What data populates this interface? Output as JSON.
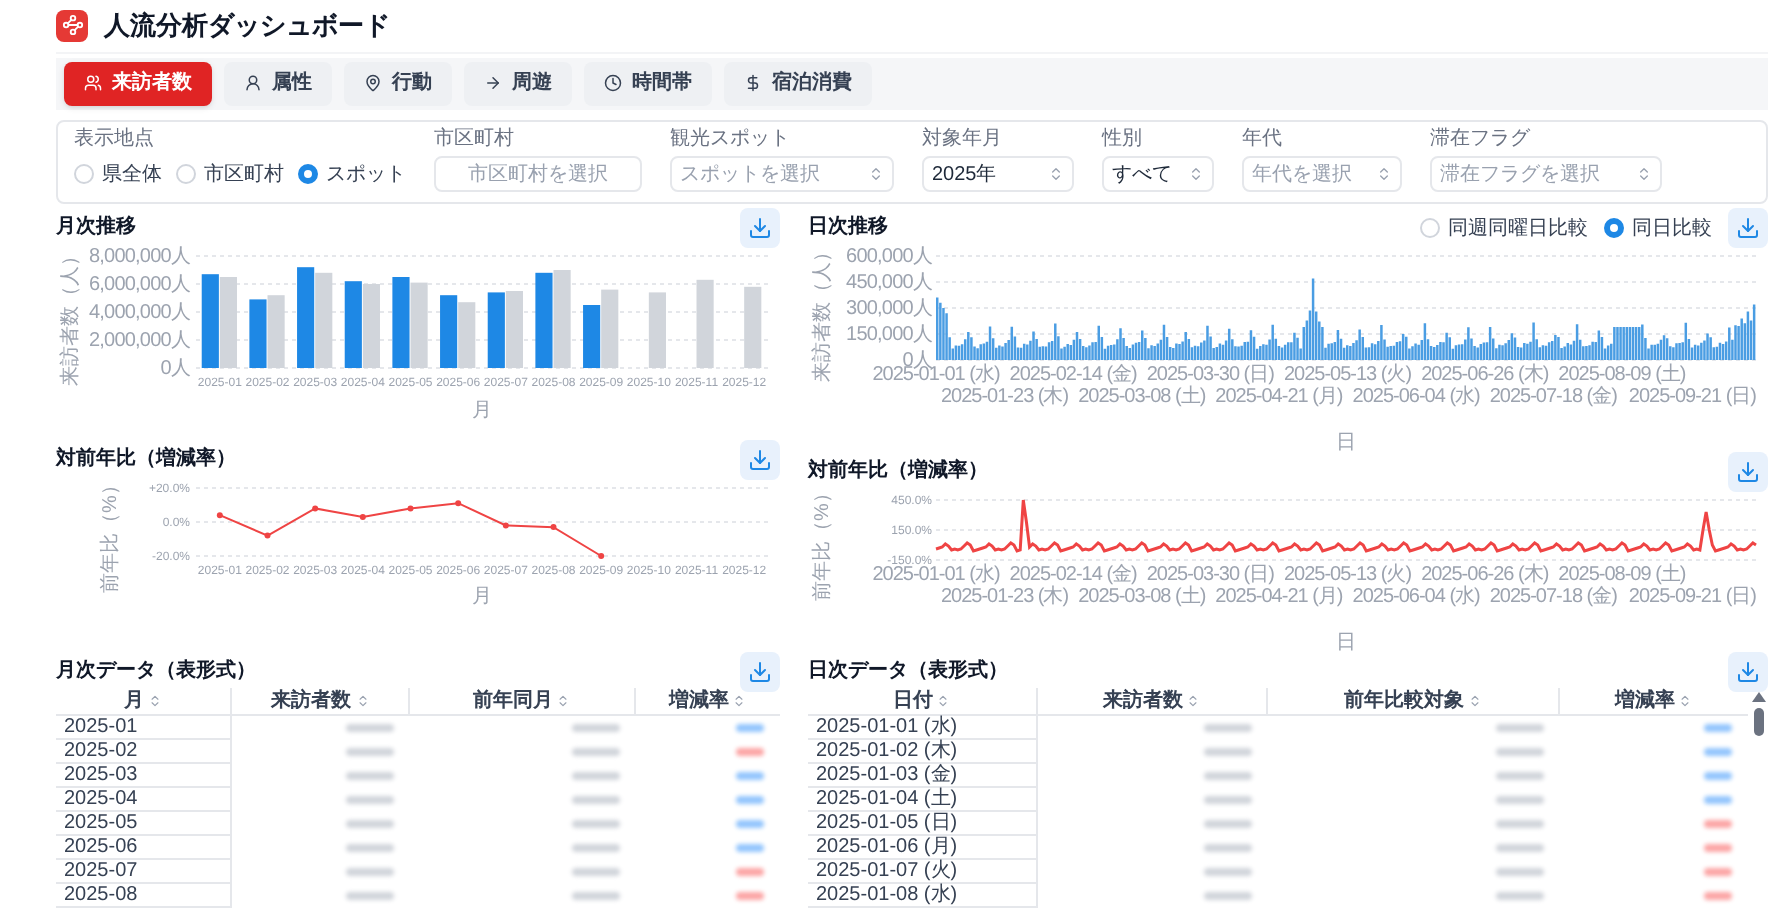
{
  "header": {
    "title": "人流分析ダッシュボード"
  },
  "tabs": [
    {
      "label": "来訪者数",
      "selected": true
    },
    {
      "label": "属性",
      "selected": false
    },
    {
      "label": "行動",
      "selected": false
    },
    {
      "label": "周遊",
      "selected": false
    },
    {
      "label": "時間帯",
      "selected": false
    },
    {
      "label": "宿泊消費",
      "selected": false
    }
  ],
  "filters": {
    "location": {
      "label": "表示地点",
      "options": [
        {
          "label": "県全体",
          "selected": false
        },
        {
          "label": "市区町村",
          "selected": false
        },
        {
          "label": "スポット",
          "selected": true
        }
      ]
    },
    "fields": [
      {
        "kind": "input",
        "label": "市区町村",
        "placeholder": "市区町村を選択"
      },
      {
        "kind": "select",
        "label": "観光スポット",
        "placeholder": "スポットを選択"
      },
      {
        "kind": "select",
        "label": "対象年月",
        "value": "2025年"
      },
      {
        "kind": "select",
        "label": "性別",
        "value": "すべて"
      },
      {
        "kind": "select",
        "label": "年代",
        "placeholder": "年代を選択"
      },
      {
        "kind": "select",
        "label": "滞在フラグ",
        "placeholder": "滞在フラグを選択"
      }
    ]
  },
  "monthly_trend": {
    "title": "月次推移",
    "chart_data": {
      "type": "bar",
      "xlabel": "月",
      "ylabel": "来訪者数（人）",
      "categories": [
        "2025-01",
        "2025-02",
        "2025-03",
        "2025-04",
        "2025-05",
        "2025-06",
        "2025-07",
        "2025-08",
        "2025-09",
        "2025-10",
        "2025-11",
        "2025-12"
      ],
      "grid": true,
      "series": [
        {
          "color": "#1e88e5",
          "values": [
            6700000,
            4900000,
            7200000,
            6200000,
            6500000,
            5200000,
            5400000,
            6800000,
            4500000,
            null,
            null,
            null
          ]
        },
        {
          "color": "#d1d5db",
          "values": [
            6500000,
            5200000,
            6800000,
            6000000,
            6100000,
            4700000,
            5500000,
            7000000,
            5600000,
            5400000,
            6300000,
            5800000
          ]
        }
      ],
      "ylim": [
        0,
        8000000
      ],
      "yticks": [
        {
          "value": 0,
          "label": "0人"
        },
        {
          "value": 2000000,
          "label": "2,000,000人"
        },
        {
          "value": 4000000,
          "label": "4,000,000人"
        },
        {
          "value": 6000000,
          "label": "6,000,000人"
        },
        {
          "value": 8000000,
          "label": "8,000,000人"
        }
      ]
    }
  },
  "monthly_yoy": {
    "title": "対前年比（増減率）",
    "chart_data": {
      "type": "line",
      "xlabel": "月",
      "ylabel": "前年比（%）",
      "categories": [
        "2025-01",
        "2025-02",
        "2025-03",
        "2025-04",
        "2025-05",
        "2025-06",
        "2025-07",
        "2025-08",
        "2025-09",
        "2025-10",
        "2025-11",
        "2025-12"
      ],
      "grid": true,
      "series": [
        {
          "color": "#ef4444",
          "marker": "circle",
          "values": [
            4,
            -8,
            8,
            3,
            8,
            11,
            -2,
            -3,
            -20,
            null,
            null,
            null
          ]
        }
      ],
      "ylim": [
        -20,
        20
      ],
      "yticks": [
        {
          "value": -20,
          "label": "-20.0%"
        },
        {
          "value": 0,
          "label": "0.0%"
        },
        {
          "value": 20,
          "label": "+20.0%"
        }
      ]
    }
  },
  "daily_trend": {
    "title": "日次推移",
    "comparison": [
      {
        "label": "同週同曜日比較",
        "selected": false
      },
      {
        "label": "同日比較",
        "selected": true
      }
    ],
    "ylabel": "来訪者数（人）",
    "xlabel": "日",
    "y_ticks": [
      "600,000人",
      "450,000人",
      "300,000人",
      "150,000人",
      "0人"
    ],
    "x_ticks": [
      "2025-01-01 (水)",
      "2025-01-23 (木)",
      "2025-02-14 (金)",
      "2025-03-08 (土)",
      "2025-03-30 (日)",
      "2025-04-21 (月)",
      "2025-05-13 (火)",
      "2025-06-04 (水)",
      "2025-06-26 (木)",
      "2025-07-18 (金)",
      "2025-08-09 (土)",
      "2025-09-21 (日)"
    ]
  },
  "daily_yoy": {
    "title": "対前年比（増減率）",
    "chart_data": {
      "type": "line",
      "ylabel": "前年比（%）",
      "xlabel": "日",
      "grid": true,
      "ylim": [
        -150,
        450
      ],
      "yticks": [
        {
          "value": 450,
          "label": "450.0%"
        },
        {
          "value": 150,
          "label": "150.0%"
        },
        {
          "value": -150,
          "label": "-150.0%"
        }
      ],
      "series": [
        {
          "color": "#ef4444",
          "values": [
            -40,
            -30,
            -20,
            10,
            -10,
            -50,
            -40,
            -50,
            -40,
            -10,
            20,
            0,
            -60,
            -50,
            -40,
            -30,
            -20,
            10,
            -10,
            -50,
            -40,
            -50,
            -40,
            -10,
            20,
            0,
            -60,
            -50,
            450,
            230,
            -20,
            10,
            -10,
            -50,
            -40,
            -50,
            -40,
            -10,
            20,
            0,
            -60,
            -50,
            -40,
            -30,
            -20,
            10,
            -10,
            -50,
            -40,
            -50,
            -40,
            -10,
            20,
            0,
            -60,
            -50,
            -40,
            -30,
            -20,
            10,
            -10,
            -50,
            -40,
            -50,
            -40,
            -10,
            20,
            0,
            -60,
            -50,
            -40,
            -30,
            -20,
            10,
            -10,
            -50,
            -40,
            -50,
            -40,
            -10,
            20,
            0,
            -60,
            -50,
            -40,
            -30,
            -20,
            10,
            -10,
            -50,
            -40,
            -50,
            -40,
            -10,
            20,
            0,
            -60,
            -50,
            -40,
            -30,
            -20,
            10,
            -10,
            -50,
            -40,
            -50,
            -40,
            -10,
            20,
            0,
            -60,
            -50,
            -40,
            -30,
            -20,
            10,
            -10,
            -50,
            -40,
            -50,
            -40,
            -10,
            20,
            0,
            -60,
            -50,
            -40,
            -30,
            -20,
            10,
            -10,
            -50,
            -40,
            -50,
            -40,
            -10,
            20,
            0,
            -60,
            -50,
            -40,
            -30,
            -20,
            10,
            -10,
            -50,
            -40,
            -50,
            -40,
            -10,
            20,
            0,
            -60,
            -50,
            -40,
            -30,
            -20,
            10,
            -10,
            -50,
            -40,
            -50,
            -40,
            -10,
            20,
            0,
            -60,
            -50,
            -40,
            -30,
            -20,
            10,
            -10,
            -50,
            -40,
            -50,
            -40,
            -10,
            20,
            0,
            -60,
            -50,
            -40,
            -30,
            -20,
            10,
            -10,
            -50,
            -40,
            -50,
            -40,
            -10,
            20,
            0,
            -60,
            -50,
            -40,
            -30,
            -20,
            10,
            -10,
            -50,
            -40,
            -50,
            -40,
            -10,
            20,
            0,
            -60,
            -50,
            -40,
            -30,
            -20,
            10,
            -10,
            -50,
            -40,
            -50,
            -40,
            -10,
            20,
            0,
            -60,
            -50,
            -40,
            -30,
            -20,
            10,
            -10,
            -50,
            -40,
            -50,
            -40,
            -10,
            20,
            0,
            -60,
            -50,
            -40,
            -30,
            -20,
            10,
            -10,
            -50,
            -40,
            -50,
            150,
            330,
            150,
            0,
            -60,
            -50,
            -40,
            -30,
            -20,
            10,
            -10,
            -50,
            -40,
            -50,
            -40,
            -10,
            20,
            0
          ]
        }
      ]
    },
    "x_ticks": [
      "2025-01-01 (水)",
      "2025-01-23 (木)",
      "2025-02-14 (金)",
      "2025-03-08 (土)",
      "2025-03-30 (日)",
      "2025-04-21 (月)",
      "2025-05-13 (火)",
      "2025-06-04 (水)",
      "2025-06-26 (木)",
      "2025-07-18 (金)",
      "2025-08-09 (土)",
      "2025-09-21 (日)"
    ]
  },
  "monthly_table": {
    "title": "月次データ（表形式）",
    "columns": [
      "月",
      "来訪者数",
      "前年同月",
      "増減率"
    ],
    "rows": [
      {
        "label": "2025-01",
        "color": "#93c5fd"
      },
      {
        "label": "2025-02",
        "color": "#fca5a5"
      },
      {
        "label": "2025-03",
        "color": "#93c5fd"
      },
      {
        "label": "2025-04",
        "color": "#93c5fd"
      },
      {
        "label": "2025-05",
        "color": "#93c5fd"
      },
      {
        "label": "2025-06",
        "color": "#93c5fd"
      },
      {
        "label": "2025-07",
        "color": "#fca5a5"
      },
      {
        "label": "2025-08",
        "color": "#fca5a5"
      }
    ]
  },
  "daily_table": {
    "title": "日次データ（表形式）",
    "columns": [
      "日付",
      "来訪者数",
      "前年比較対象",
      "増減率"
    ],
    "rows": [
      {
        "label": "2025-01-01 (水)",
        "color": "#93c5fd"
      },
      {
        "label": "2025-01-02 (木)",
        "color": "#93c5fd"
      },
      {
        "label": "2025-01-03 (金)",
        "color": "#93c5fd"
      },
      {
        "label": "2025-01-04 (土)",
        "color": "#93c5fd"
      },
      {
        "label": "2025-01-05 (日)",
        "color": "#fca5a5"
      },
      {
        "label": "2025-01-06 (月)",
        "color": "#fca5a5"
      },
      {
        "label": "2025-01-07 (火)",
        "color": "#fca5a5"
      },
      {
        "label": "2025-01-08 (水)",
        "color": "#fca5a5"
      }
    ]
  }
}
